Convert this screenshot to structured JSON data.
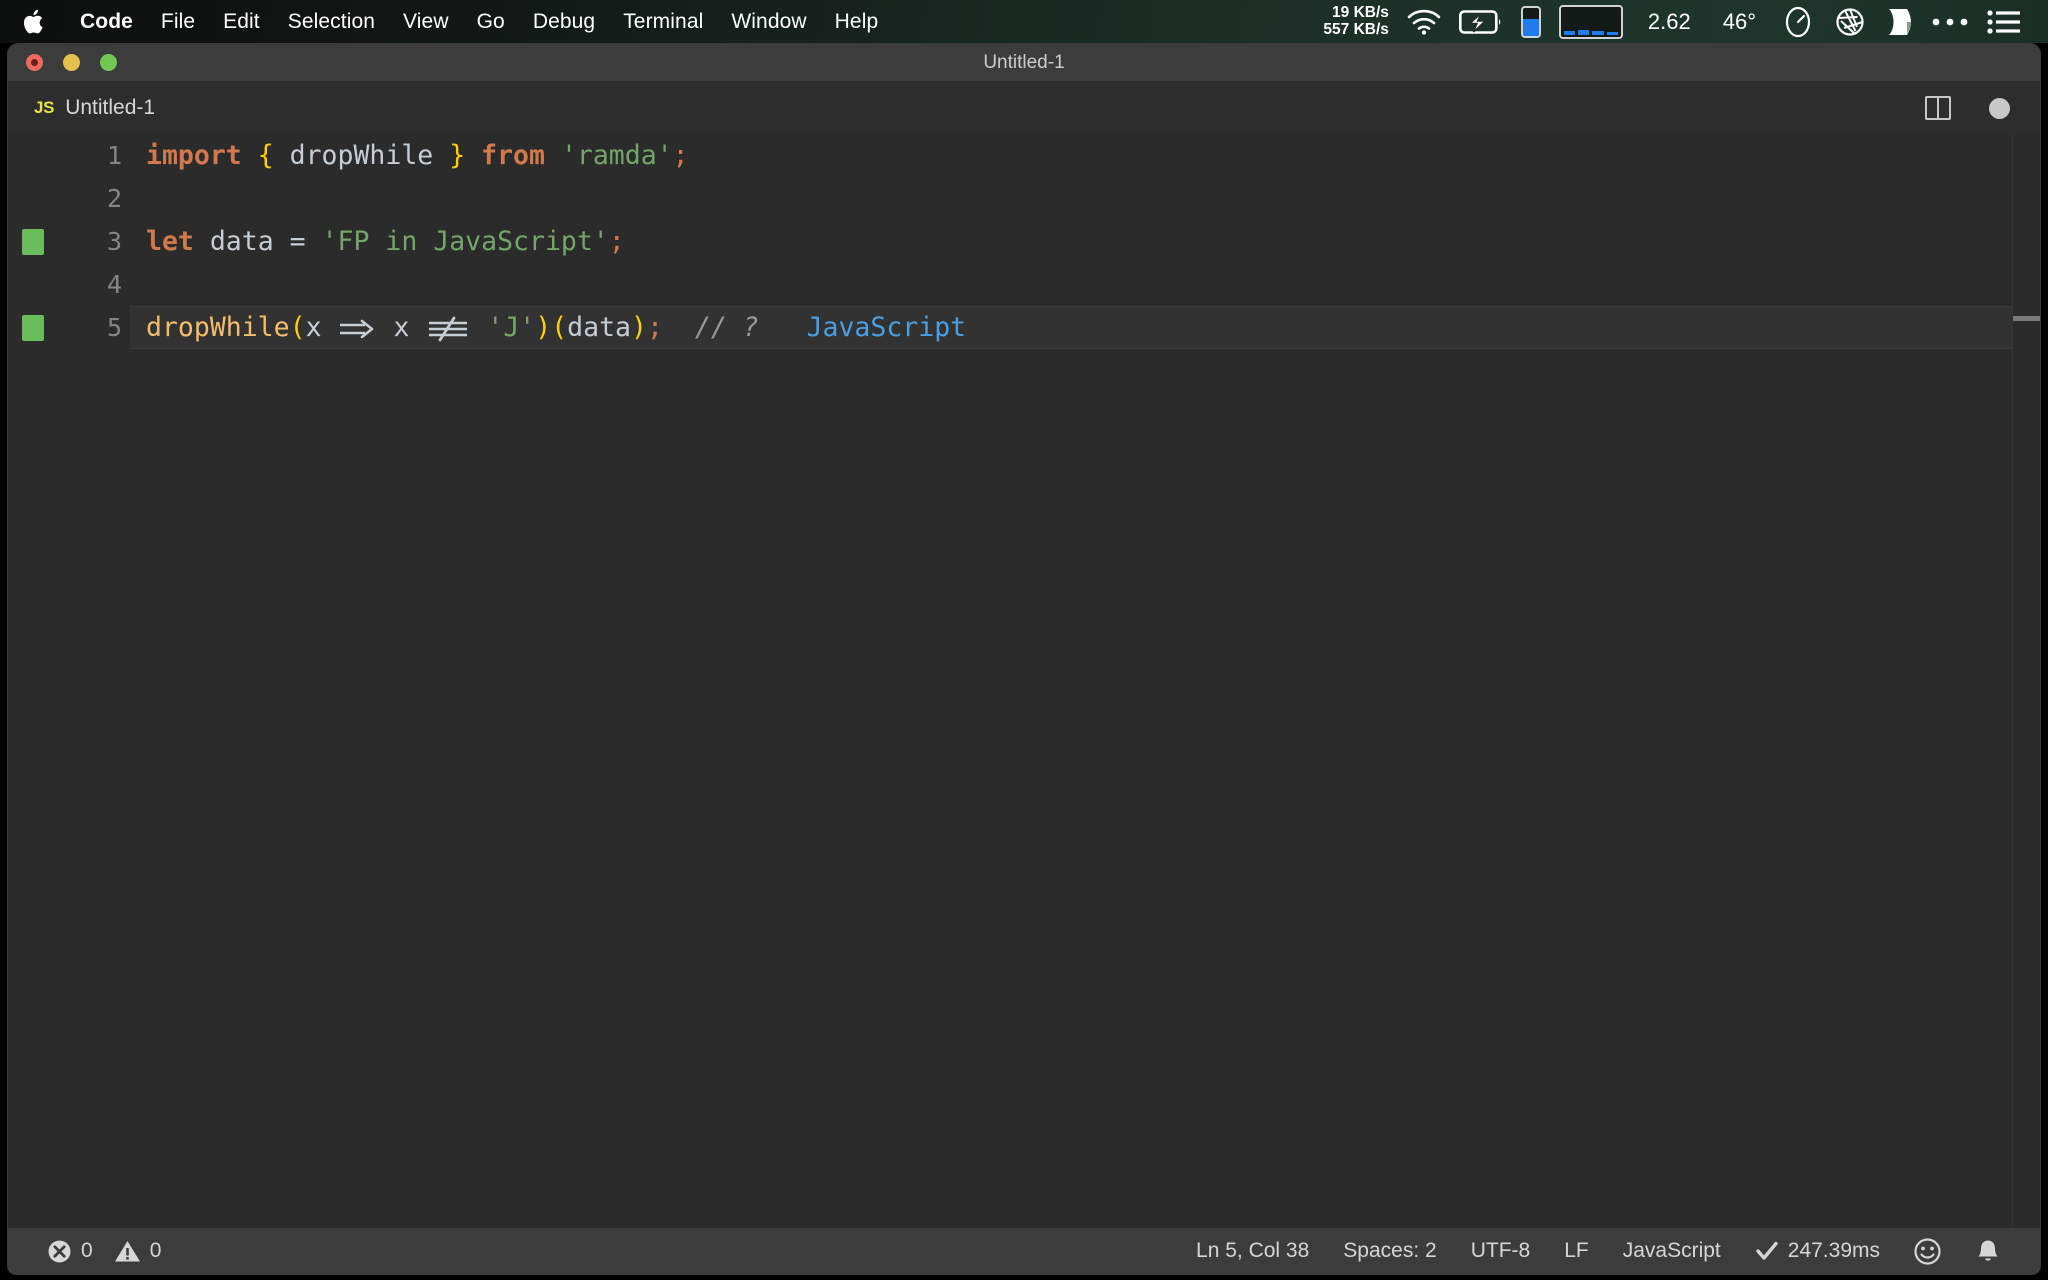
{
  "menubar": {
    "apple_icon": "apple-logo-icon",
    "items": [
      {
        "label": "Code",
        "bold": true
      },
      {
        "label": "File",
        "bold": false
      },
      {
        "label": "Edit",
        "bold": false
      },
      {
        "label": "Selection",
        "bold": false
      },
      {
        "label": "View",
        "bold": false
      },
      {
        "label": "Go",
        "bold": false
      },
      {
        "label": "Debug",
        "bold": false
      },
      {
        "label": "Terminal",
        "bold": false
      },
      {
        "label": "Window",
        "bold": false
      },
      {
        "label": "Help",
        "bold": false
      }
    ],
    "status": {
      "net_up": "19 KB/s",
      "net_down": "557 KB/s",
      "wifi_icon": "wifi-icon",
      "battery_icon": "battery-charging-icon",
      "memory_meter_icon": "memory-meter-icon",
      "cpu_graph_icon": "cpu-graph-icon",
      "load_value": "2.62",
      "temperature": "46°",
      "gauge_icon": "speed-gauge-icon",
      "aperture_icon": "aperture-icon",
      "shield_icon": "bartender-icon",
      "ellipsis_icon": "ellipsis-icon",
      "list_icon": "list-menu-icon"
    },
    "colors": {
      "accent_blue": "#1f7ced",
      "bar_green_tint": "#1d322a"
    }
  },
  "window": {
    "title": "Untitled-1",
    "traffic": {
      "close": "close-button",
      "minimize": "minimize-button",
      "zoom": "zoom-button"
    }
  },
  "tab": {
    "badge": "JS",
    "label": "Untitled-1",
    "split_editor_label": "split-editor",
    "dirty_label": "unsaved-changes"
  },
  "editor": {
    "lines": [
      {
        "number": "1",
        "gutter": "",
        "tokens": [
          {
            "text": "import",
            "cls": "t-kw"
          },
          {
            "text": " ",
            "cls": "t-plain"
          },
          {
            "text": "{",
            "cls": "t-brace"
          },
          {
            "text": " ",
            "cls": "t-plain"
          },
          {
            "text": "dropWhile",
            "cls": "t-var"
          },
          {
            "text": " ",
            "cls": "t-plain"
          },
          {
            "text": "}",
            "cls": "t-brace"
          },
          {
            "text": " ",
            "cls": "t-plain"
          },
          {
            "text": "from",
            "cls": "t-kw"
          },
          {
            "text": " ",
            "cls": "t-plain"
          },
          {
            "text": "'ramda'",
            "cls": "t-str"
          },
          {
            "text": ";",
            "cls": "t-semi"
          }
        ]
      },
      {
        "number": "2",
        "gutter": "",
        "tokens": []
      },
      {
        "number": "3",
        "gutter": "added",
        "tokens": [
          {
            "text": "let",
            "cls": "t-kw"
          },
          {
            "text": " ",
            "cls": "t-plain"
          },
          {
            "text": "data",
            "cls": "t-var"
          },
          {
            "text": " ",
            "cls": "t-plain"
          },
          {
            "text": "=",
            "cls": "t-op"
          },
          {
            "text": " ",
            "cls": "t-plain"
          },
          {
            "text": "'FP in JavaScript'",
            "cls": "t-str"
          },
          {
            "text": ";",
            "cls": "t-semi"
          }
        ]
      },
      {
        "number": "4",
        "gutter": "",
        "tokens": []
      },
      {
        "number": "5",
        "gutter": "added",
        "current": true,
        "tokens": [
          {
            "text": "dropWhile",
            "cls": "t-fn"
          },
          {
            "text": "(",
            "cls": "t-paren"
          },
          {
            "text": "x",
            "cls": "t-var"
          },
          {
            "text": " ",
            "cls": "t-plain"
          },
          {
            "text": "=>",
            "cls": "t-op",
            "ligature": "arrow"
          },
          {
            "text": " ",
            "cls": "t-plain"
          },
          {
            "text": "x",
            "cls": "t-var"
          },
          {
            "text": " ",
            "cls": "t-plain"
          },
          {
            "text": "!==",
            "cls": "t-op",
            "ligature": "neq"
          },
          {
            "text": " ",
            "cls": "t-plain"
          },
          {
            "text": "'J'",
            "cls": "t-str"
          },
          {
            "text": ")(",
            "cls": "t-paren"
          },
          {
            "text": "data",
            "cls": "t-var"
          },
          {
            "text": ")",
            "cls": "t-paren"
          },
          {
            "text": ";",
            "cls": "t-semi"
          },
          {
            "text": "  ",
            "cls": "t-plain"
          },
          {
            "text": "// ?",
            "cls": "t-comment"
          },
          {
            "text": "   ",
            "cls": "t-plain"
          },
          {
            "text": "JavaScript",
            "cls": "t-result"
          }
        ]
      }
    ],
    "colors": {
      "background": "#2b2b2b",
      "keyword": "#d2784b",
      "brace": "#ffd000",
      "string": "#74a569",
      "variable": "#c5cdd6",
      "function": "#f5bd6b",
      "comment": "#9a9a9a",
      "inline_result": "#4a9fe0",
      "gutter_added": "#6bbd5b"
    }
  },
  "statusbar": {
    "errors_icon": "error-circle-icon",
    "errors_count": "0",
    "warnings_icon": "warning-triangle-icon",
    "warnings_count": "0",
    "cursor_position": "Ln 5, Col 38",
    "indentation": "Spaces: 2",
    "encoding": "UTF-8",
    "eol": "LF",
    "language": "JavaScript",
    "run_status_icon": "check-icon",
    "run_time": "247.39ms",
    "feedback_icon": "smiley-icon",
    "notifications_icon": "bell-icon"
  }
}
